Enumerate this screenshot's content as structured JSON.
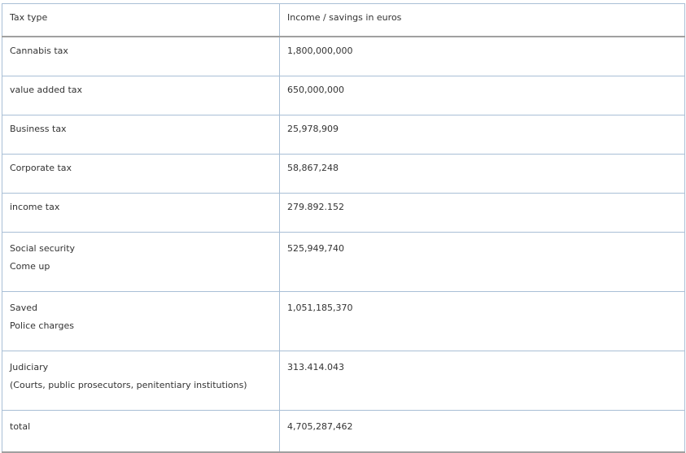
{
  "table": {
    "headers": [
      "Tax type",
      "Income / savings in euros"
    ],
    "rows": [
      {
        "type_lines": [
          "Cannabis tax"
        ],
        "amount": "1,800,000,000"
      },
      {
        "type_lines": [
          "value added tax"
        ],
        "amount": "650,000,000"
      },
      {
        "type_lines": [
          "Business tax"
        ],
        "amount": "25,978,909"
      },
      {
        "type_lines": [
          "Corporate tax"
        ],
        "amount": "58,867,248"
      },
      {
        "type_lines": [
          "income tax"
        ],
        "amount": "279.892.152"
      },
      {
        "type_lines": [
          "Social security",
          "Come up"
        ],
        "amount": "525,949,740"
      },
      {
        "type_lines": [
          "Saved",
          "Police charges"
        ],
        "amount": "1,051,185,370"
      },
      {
        "type_lines": [
          "Judiciary",
          "(Courts, public prosecutors, penitentiary institutions)"
        ],
        "amount": "313.414.043"
      },
      {
        "type_lines": [
          "total"
        ],
        "amount": "4,705,287,462"
      }
    ]
  }
}
